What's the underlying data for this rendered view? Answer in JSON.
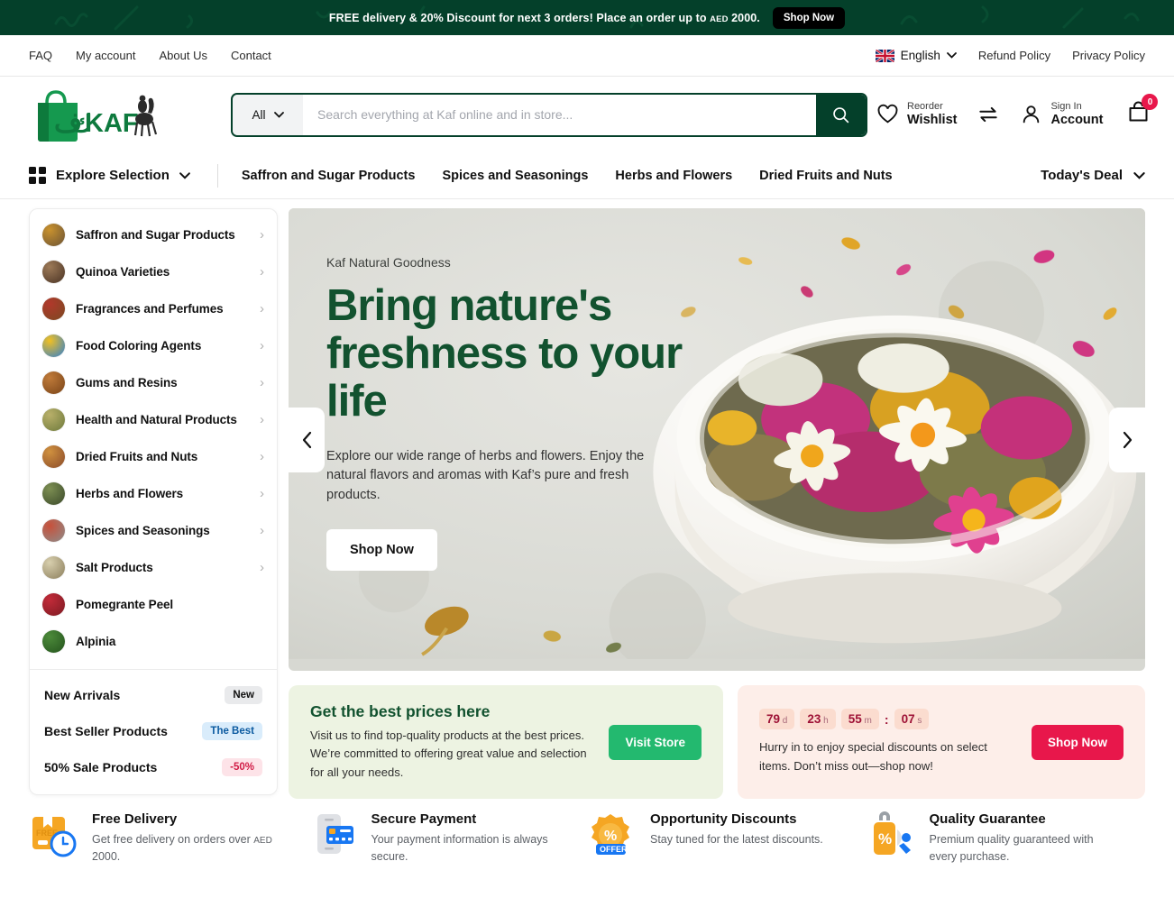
{
  "promo_banner": {
    "text_before": "FREE delivery & 20% Discount for next 3 orders! Place an order up to ",
    "currency": "AED",
    "text_after": " 2000.",
    "button": "Shop Now",
    "background": "#04402a"
  },
  "utility_bar": {
    "links": [
      {
        "label": "FAQ"
      },
      {
        "label": "My account"
      },
      {
        "label": "About Us"
      },
      {
        "label": "Contact"
      }
    ],
    "language": {
      "label": "English",
      "flag": "uk-flag-icon",
      "chevron": "chevron-down-icon"
    },
    "policy_links": [
      {
        "label": "Refund Policy"
      },
      {
        "label": "Privacy Policy"
      }
    ]
  },
  "header": {
    "logo_text": "KAF",
    "logo_arabic": "كاف",
    "search": {
      "category_selected": "All",
      "placeholder": "Search everything at Kaf online and in store...",
      "value": "",
      "button_icon": "search-icon"
    },
    "actions": [
      {
        "icon": "heart-icon",
        "top": "Reorder",
        "bottom": "Wishlist"
      },
      {
        "icon": "compare-icon",
        "top": "",
        "bottom": ""
      },
      {
        "icon": "user-icon",
        "top": "Sign In",
        "bottom": "Account"
      }
    ],
    "cart": {
      "icon": "cart-bag-icon",
      "count": "0",
      "badge_color": "#e8174b"
    }
  },
  "nav": {
    "explore_label": "Explore Selection",
    "links": [
      {
        "label": "Saffron and Sugar Products"
      },
      {
        "label": "Spices and Seasonings"
      },
      {
        "label": "Herbs and Flowers"
      },
      {
        "label": "Dried Fruits and Nuts"
      }
    ],
    "todays_deal": "Today's Deal"
  },
  "sidebar": {
    "categories": [
      {
        "label": "Saffron and Sugar Products",
        "has_chevron": true,
        "c1": "#c9922e",
        "c2": "#6b5335"
      },
      {
        "label": "Quinoa Varieties",
        "has_chevron": true,
        "c1": "#9d7a58",
        "c2": "#4a3324"
      },
      {
        "label": "Fragrances and Perfumes",
        "has_chevron": true,
        "c1": "#b1382b",
        "c2": "#7b4a22"
      },
      {
        "label": "Food Coloring Agents",
        "has_chevron": true,
        "c1": "#f2c021",
        "c2": "#2f7fd1"
      },
      {
        "label": "Gums and Resins",
        "has_chevron": true,
        "c1": "#c07b3a",
        "c2": "#7a4418"
      },
      {
        "label": "Health and Natural Products",
        "has_chevron": true,
        "c1": "#b9b06a",
        "c2": "#6e7a3c"
      },
      {
        "label": "Dried Fruits and Nuts",
        "has_chevron": true,
        "c1": "#d0913f",
        "c2": "#8a4b2a"
      },
      {
        "label": "Herbs and Flowers",
        "has_chevron": true,
        "c1": "#7d8f53",
        "c2": "#3b4a2a"
      },
      {
        "label": "Spices and Seasonings",
        "has_chevron": true,
        "c1": "#c8503a",
        "c2": "#8d8d8b"
      },
      {
        "label": "Salt Products",
        "has_chevron": true,
        "c1": "#d8cfae",
        "c2": "#8b7e5c"
      },
      {
        "label": "Pomegrante Peel",
        "has_chevron": false,
        "c1": "#c22b39",
        "c2": "#7d1a22"
      },
      {
        "label": "Alpinia",
        "has_chevron": false,
        "c1": "#4c8a3a",
        "c2": "#24541d"
      }
    ],
    "promos": [
      {
        "label": "New Arrivals",
        "tag": "New",
        "tag_style": "tag-new"
      },
      {
        "label": "Best Seller Products",
        "tag": "The Best",
        "tag_style": "tag-best"
      },
      {
        "label": "50% Sale Products",
        "tag": "-50%",
        "tag_style": "tag-sale"
      }
    ]
  },
  "hero": {
    "eyebrow": "Kaf Natural Goodness",
    "title": "Bring nature's freshness to your life",
    "description": "Explore our wide range of herbs and flowers. Enjoy the natural flavors and aromas with Kaf’s pure and fresh products.",
    "button": "Shop Now",
    "prev_icon": "chevron-left-icon",
    "next_icon": "chevron-right-icon",
    "title_color": "#12522f"
  },
  "promo_cards": {
    "store": {
      "title": "Get the best prices here",
      "text": "Visit us to find top-quality products at the best prices. We’re committed to offering great value and selection for all your needs.",
      "button": "Visit Store",
      "button_color": "#23b96f",
      "background": "#edf3e2"
    },
    "deal": {
      "countdown": [
        {
          "value": "79",
          "unit": "d"
        },
        {
          "value": "23",
          "unit": "h"
        },
        {
          "value": "55",
          "unit": "m"
        },
        {
          "value": "07",
          "unit": "s"
        }
      ],
      "separator": ":",
      "text": "Hurry in to enjoy special discounts on select items. Don’t miss out—shop now!",
      "button": "Shop Now",
      "button_color": "#e8174b",
      "background": "#fdeee9"
    }
  },
  "features": [
    {
      "icon": "delivery-box-clock-icon",
      "title": "Free Delivery",
      "text_before": "Get free delivery on orders over ",
      "currency": "AED",
      "text_after": " 2000."
    },
    {
      "icon": "secure-payment-icon",
      "title": "Secure Payment",
      "text_before": "Your payment information is always secure.",
      "currency": "",
      "text_after": ""
    },
    {
      "icon": "offer-discount-icon",
      "title": "Opportunity Discounts",
      "text_before": "Stay tuned for the latest discounts.",
      "currency": "",
      "text_after": ""
    },
    {
      "icon": "quality-tag-icon",
      "title": "Quality Guarantee",
      "text_before": "Premium quality guaranteed with every purchase.",
      "currency": "",
      "text_after": ""
    }
  ]
}
